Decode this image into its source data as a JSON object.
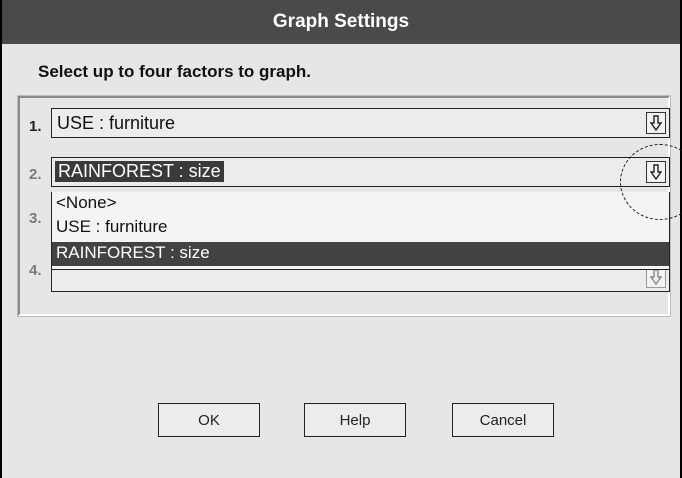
{
  "window": {
    "title": "Graph Settings"
  },
  "instruction": "Select up to four factors to graph.",
  "factors": [
    {
      "number": "1.",
      "value": "USE : furniture"
    },
    {
      "number": "2.",
      "value": "RAINFOREST : size"
    },
    {
      "number": "3.",
      "value": ""
    },
    {
      "number": "4.",
      "value": ""
    }
  ],
  "dropdown": {
    "options": [
      "<None>",
      "USE : furniture",
      "RAINFOREST : size"
    ],
    "highlighted": "RAINFOREST : size"
  },
  "buttons": {
    "ok": "OK",
    "help": "Help",
    "cancel": "Cancel"
  },
  "icons": {
    "dropdown_arrow": "down-arrow-icon"
  },
  "colors": {
    "titlebar": "#4a4a4a",
    "highlight": "#424242",
    "dialog_bg": "#e6e6e6"
  }
}
